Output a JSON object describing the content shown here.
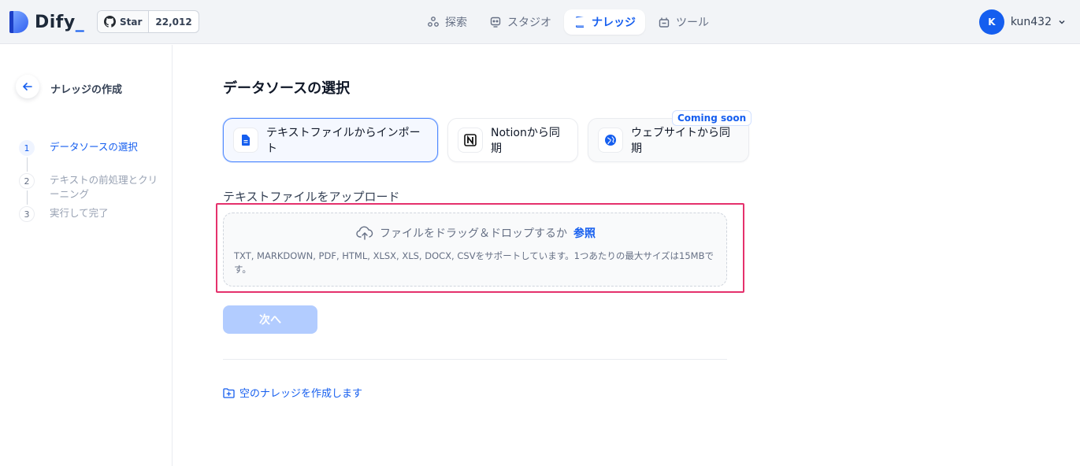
{
  "brand": {
    "name": "Dify",
    "accent_color": "#155eef"
  },
  "github": {
    "star_label": "Star",
    "star_count": "22,012",
    "icon": "github-icon"
  },
  "nav": [
    {
      "label": "探索",
      "icon": "explore-icon",
      "active": false
    },
    {
      "label": "スタジオ",
      "icon": "studio-icon",
      "active": false
    },
    {
      "label": "ナレッジ",
      "icon": "knowledge-icon",
      "active": true
    },
    {
      "label": "ツール",
      "icon": "tools-icon",
      "active": false
    }
  ],
  "user": {
    "initial": "K",
    "name": "kun432"
  },
  "sidebar": {
    "title": "ナレッジの作成",
    "steps": [
      {
        "num": "1",
        "label": "データソースの選択",
        "active": true
      },
      {
        "num": "2",
        "label": "テキストの前処理とクリーニング",
        "active": false
      },
      {
        "num": "3",
        "label": "実行して完了",
        "active": false
      }
    ]
  },
  "main": {
    "title": "データソースの選択",
    "sources": [
      {
        "label": "テキストファイルからインポート",
        "icon": "file-icon",
        "active": true
      },
      {
        "label": "Notionから同期",
        "icon": "notion-icon",
        "active": false
      },
      {
        "label": "ウェブサイトから同期",
        "icon": "globe-icon",
        "active": false,
        "badge": "Coming soon"
      }
    ],
    "upload_label": "テキストファイルをアップロード",
    "dropzone": {
      "text": "ファイルをドラッグ＆ドロップするか",
      "browse": "参照",
      "tip": "TXT, MARKDOWN, PDF, HTML, XLSX, XLS, DOCX, CSVをサポートしています。1つあたりの最大サイズは15MBです。"
    },
    "next_button": "次へ",
    "empty_link": "空のナレッジを作成します"
  }
}
